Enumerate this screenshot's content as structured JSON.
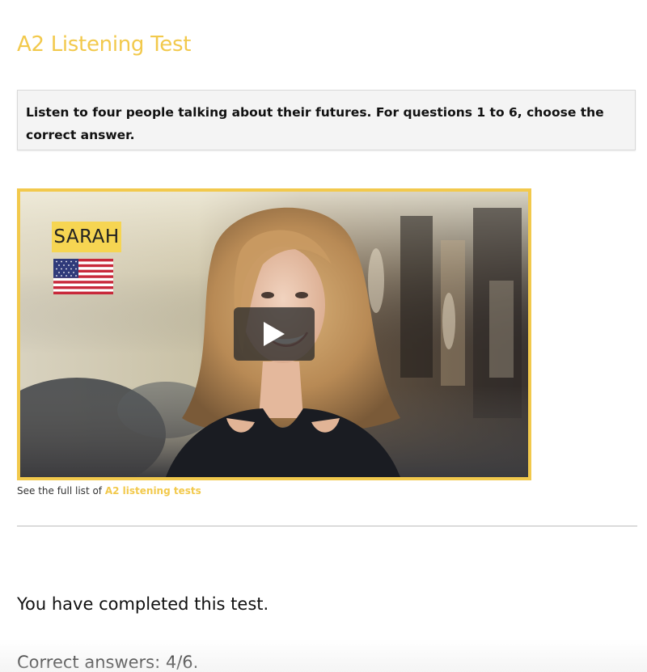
{
  "page": {
    "title": "A2 Listening Test"
  },
  "instructions": {
    "text": "Listen to four people talking about their futures. For questions 1 to 6, choose the correct answer."
  },
  "video": {
    "speaker_name": "SARAH",
    "flag_icon": "us-flag-icon",
    "play_icon": "play-icon",
    "border_color": "#f2c94c"
  },
  "caption": {
    "prefix": "See the full list of ",
    "link_label": "A2 listening tests"
  },
  "results": {
    "completed_text": "You have completed this test.",
    "score_text": "Correct answers: 4/6."
  },
  "colors": {
    "accent": "#f2c94c",
    "text": "#111111"
  }
}
